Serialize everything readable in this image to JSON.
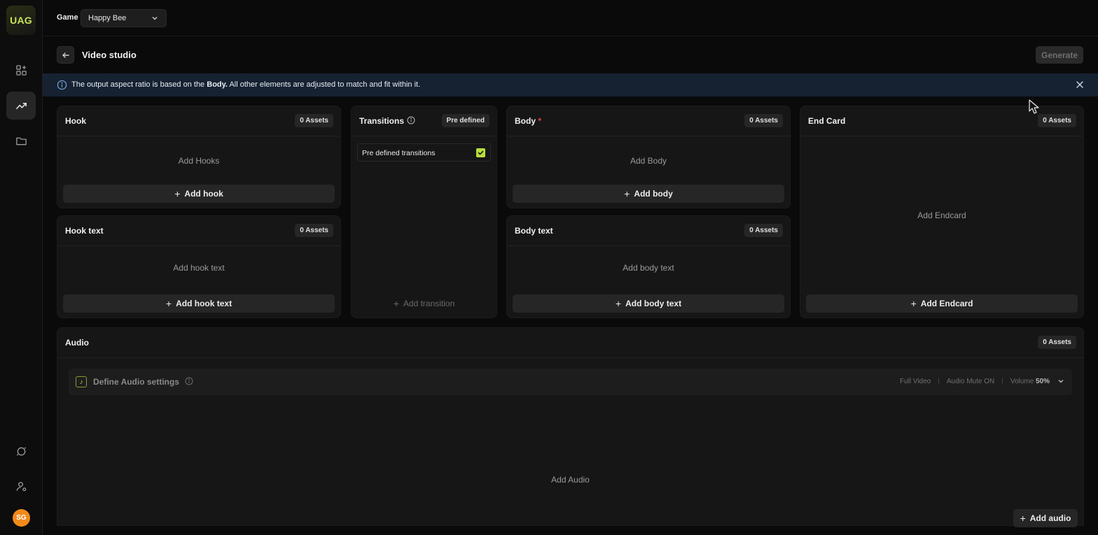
{
  "sidebar": {
    "logo": "UAG",
    "items": [
      {
        "icon": "apps-add-icon"
      },
      {
        "icon": "analytics-icon",
        "active": true
      },
      {
        "icon": "folder-icon"
      }
    ],
    "bottom": [
      {
        "icon": "support-icon"
      },
      {
        "icon": "user-settings-icon"
      }
    ],
    "avatar_initials": "SG"
  },
  "topbar": {
    "game_label": "Game",
    "game_value": "Happy Bee"
  },
  "header": {
    "title": "Video studio",
    "generate_label": "Generate"
  },
  "banner": {
    "text_before": "The output aspect ratio is based on the ",
    "text_bold": "Body.",
    "text_after": " All other elements are adjusted to match and fit within it."
  },
  "cards": {
    "hook": {
      "title": "Hook",
      "badge": "0 Assets",
      "placeholder": "Add Hooks",
      "button": "Add hook"
    },
    "hook_text": {
      "title": "Hook text",
      "badge": "0 Assets",
      "placeholder": "Add hook text",
      "button": "Add hook text"
    },
    "transitions": {
      "title": "Transitions",
      "badge": "Pre defined",
      "row_label": "Pre defined transitions",
      "checked": true,
      "button": "Add transition"
    },
    "body": {
      "title": "Body",
      "required_mark": "*",
      "badge": "0 Assets",
      "placeholder": "Add Body",
      "button": "Add body"
    },
    "body_text": {
      "title": "Body text",
      "badge": "0 Assets",
      "placeholder": "Add body text",
      "button": "Add body text"
    },
    "end_card": {
      "title": "End Card",
      "badge": "0 Assets",
      "placeholder": "Add Endcard",
      "button": "Add Endcard"
    },
    "audio": {
      "title": "Audio",
      "badge": "0 Assets",
      "settings_label": "Define Audio settings",
      "full_video": "Full Video",
      "mute": "Audio Mute ON",
      "volume_label": "Volume",
      "volume_value": "50%",
      "placeholder": "Add Audio",
      "button": "Add audio"
    }
  },
  "colors": {
    "accent": "#b7dd3a",
    "banner_bg": "#162232",
    "avatar": "#f08a1c",
    "required": "#e0473c"
  }
}
